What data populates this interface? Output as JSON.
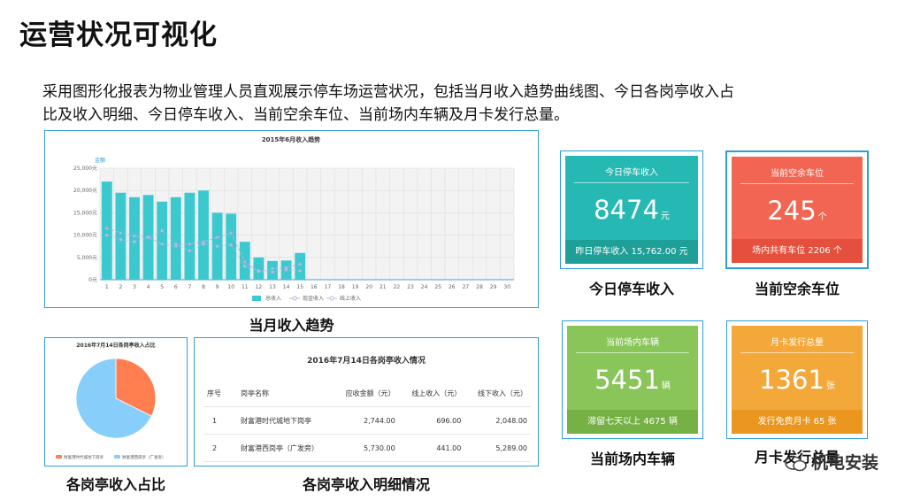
{
  "page": {
    "title": "运营状况可视化",
    "intro_line1": "采用图形化报表为物业管理人员直观展示停车场运营状况，包括当月收入趋势曲线图、今日各岗亭收入占",
    "intro_line2": "比及收入明细、今日停车收入、当前空余车位、当前场内车辆及月卡发行总量。"
  },
  "captions": {
    "trend": "当月收入趋势",
    "pie": "各岗亭收入占比",
    "table": "各岗亭收入明细情况",
    "today_income": "今日停车收入",
    "free_spaces": "当前空余车位",
    "cars_in": "当前场内车辆",
    "monthly_cards": "月卡发行总量"
  },
  "chart_data": [
    {
      "type": "bar",
      "title": "2015年6月收入趋势",
      "y_series_label": "金额",
      "categories": [
        "1",
        "2",
        "3",
        "4",
        "5",
        "6",
        "7",
        "8",
        "9",
        "10",
        "11",
        "12",
        "13",
        "14",
        "15",
        "16",
        "17",
        "18",
        "19",
        "20",
        "21",
        "22",
        "23",
        "24",
        "25",
        "26",
        "27",
        "28",
        "29",
        "30"
      ],
      "y_ticks": [
        "25,000元",
        "20,000元",
        "15,000元",
        "10,000元",
        "5,000元",
        "0元"
      ],
      "ylim": [
        0,
        25000
      ],
      "series": [
        {
          "name": "总收入",
          "type": "bar",
          "color": "#3cc8cf",
          "values": [
            22000,
            19500,
            18500,
            19000,
            17500,
            18500,
            19500,
            20000,
            15000,
            14800,
            8500,
            5000,
            4200,
            4300,
            6000
          ]
        },
        {
          "name": "现金收入",
          "type": "line",
          "color": "#b9b2e2",
          "values": [
            11500,
            10500,
            9800,
            9500,
            8000,
            7500,
            8000,
            8500,
            9500,
            10500,
            4000,
            1800,
            2500,
            2700,
            3500
          ]
        },
        {
          "name": "线上收入",
          "type": "line",
          "color": "#c7b6e4",
          "values": [
            10000,
            9000,
            8500,
            9500,
            11000,
            8000,
            6500,
            8000,
            7500,
            7800,
            3000,
            2000,
            1700,
            2200,
            2000
          ]
        }
      ],
      "legend": "bottom"
    },
    {
      "type": "pie",
      "title": "2016年7月14日各岗亭收入占比",
      "labels": [
        "财富港时代城地下岗亭",
        "财富港西岗亭（广发旁）"
      ],
      "values": [
        2744.0,
        5730.0
      ],
      "colors": [
        "#ff7f50",
        "#87cefa"
      ],
      "legend": "bottom"
    }
  ],
  "detail_table": {
    "title": "2016年7月14日各岗亭收入情况",
    "headers": [
      "序号",
      "岗亭名称",
      "应收金额（元）",
      "线上收入（元）",
      "线下收入（元）"
    ],
    "rows": [
      [
        "1",
        "财富港时代城地下岗亭",
        "2,744.00",
        "696.00",
        "2,048.00"
      ],
      [
        "2",
        "财富港西岗亭（广发旁）",
        "5,730.00",
        "441.00",
        "5,289.00"
      ]
    ]
  },
  "cards": {
    "today_income": {
      "label": "今日停车收入",
      "value": "8474",
      "unit": "元",
      "foot": "昨日停车收入 15,762.00 元",
      "color": "#26b8b2",
      "foot_color": "#1e9f98"
    },
    "free_spaces": {
      "label": "当前空余车位",
      "value": "245",
      "unit": "个",
      "foot": "场内共有车位 2206 个",
      "color": "#f26552",
      "foot_color": "#e4503d"
    },
    "cars_in": {
      "label": "当前场内车辆",
      "value": "5451",
      "unit": "辆",
      "foot": "滞留七天以上 4675 辆",
      "color": "#8ac55a",
      "foot_color": "#75b145"
    },
    "monthly_cards": {
      "label": "月卡发行总量",
      "value": "1361",
      "unit": "张",
      "foot": "发行免费月卡 65 张",
      "color": "#f4a83a",
      "foot_color": "#ea961f"
    }
  },
  "watermark": "机电安装"
}
